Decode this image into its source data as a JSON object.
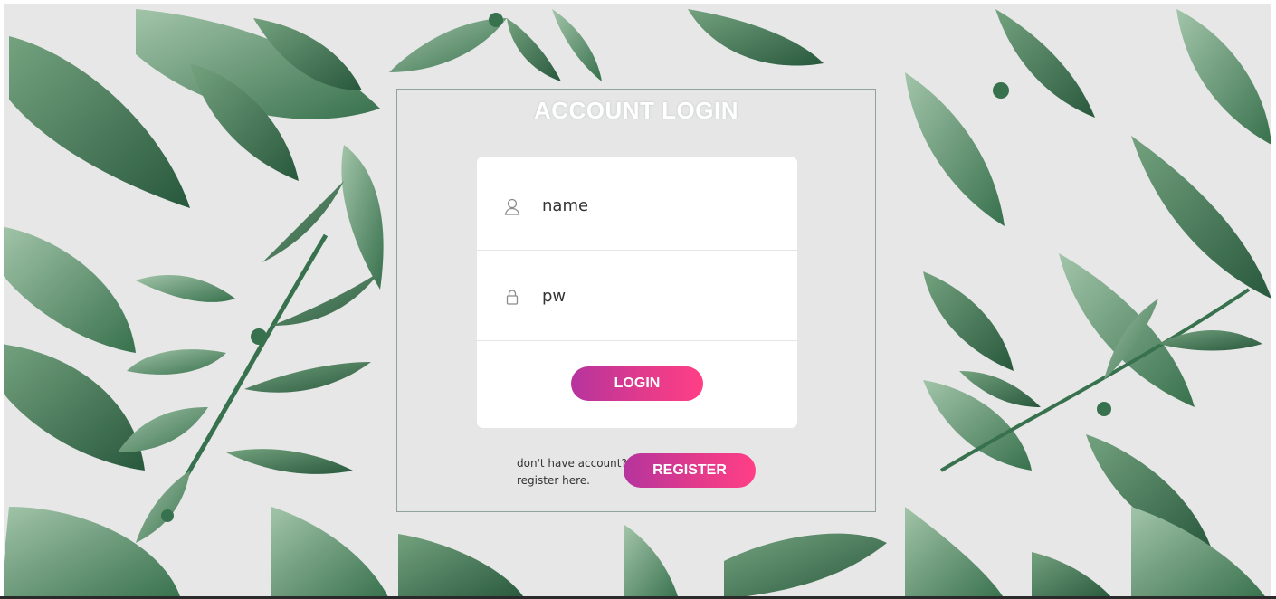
{
  "login_panel": {
    "title": "ACCOUNT LOGIN",
    "fields": {
      "name": {
        "icon": "user-icon",
        "value": "name"
      },
      "password": {
        "icon": "lock-icon",
        "value": "pw"
      }
    },
    "login_button_label": "LOGIN"
  },
  "register": {
    "prompt_line1": "don't have account?",
    "prompt_line2": "register here.",
    "button_label": "REGISTER"
  },
  "colors": {
    "background": "#e6e7e6",
    "leaf_dark": "#2f6b45",
    "leaf_light": "#7ea98a",
    "button_gradient_start": "#b5349d",
    "button_gradient_end": "#ff3f86"
  }
}
